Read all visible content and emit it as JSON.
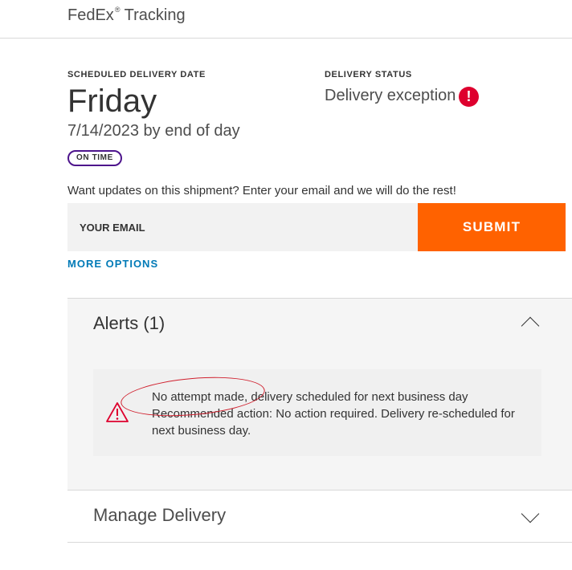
{
  "header": {
    "brand": "FedEx",
    "brand_mark": "®",
    "title": "Tracking"
  },
  "delivery": {
    "date_label": "SCHEDULED DELIVERY DATE",
    "day": "Friday",
    "date_text": "7/14/2023 by end of day",
    "badge": "ON TIME",
    "status_label": "DELIVERY STATUS",
    "status": "Delivery exception",
    "status_icon": "!"
  },
  "updates": {
    "prompt": "Want updates on this shipment? Enter your email and we will do the rest!",
    "email_placeholder": "YOUR EMAIL",
    "submit_label": "SUBMIT",
    "more_options": "MORE OPTIONS"
  },
  "alerts": {
    "title": "Alerts (1)",
    "lines": [
      "No attempt made, delivery scheduled for next business day",
      "Recommended action: No action required. Delivery re-scheduled for next business day."
    ]
  },
  "manage": {
    "title": "Manage Delivery"
  },
  "colors": {
    "submit": "#ff6200",
    "link": "#007ab7",
    "badge_border": "#4d148c",
    "exception": "#de002e",
    "annotation": "#d0202e"
  },
  "icons": {
    "status": "exclamation-circle-icon",
    "alert": "warning-triangle-icon",
    "expand": "chevron-down-icon",
    "collapse": "chevron-up-icon"
  }
}
